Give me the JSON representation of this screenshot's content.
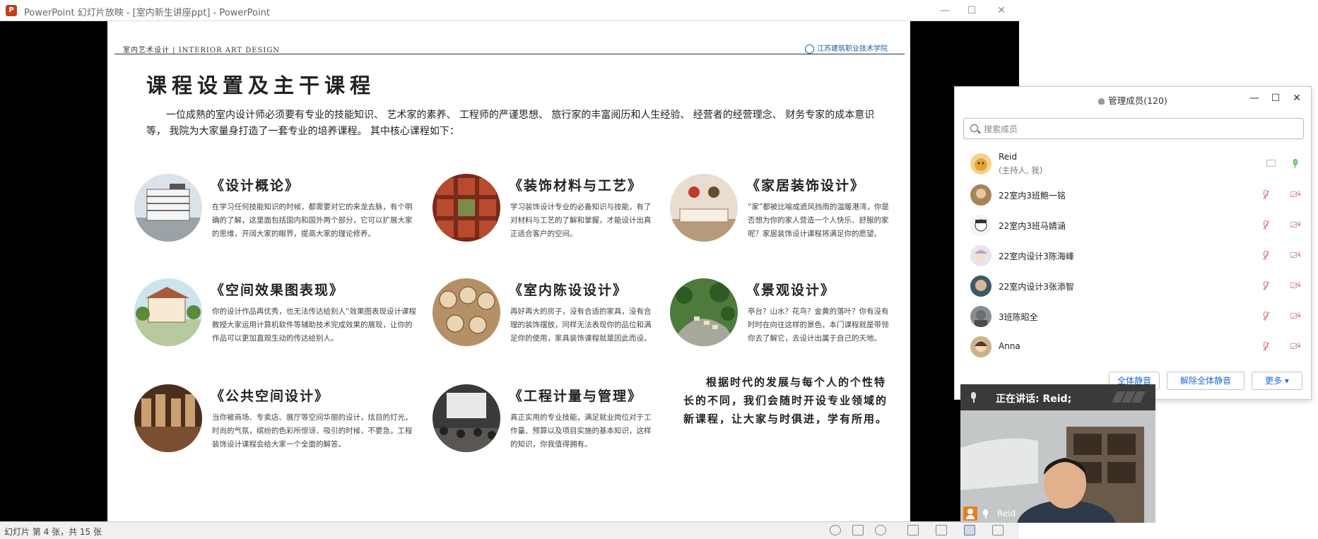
{
  "ppt": {
    "title": "PowerPoint 幻灯片放映 - [室内新生讲座ppt] - PowerPoint",
    "logo": "P",
    "status": "幻灯片 第 4 张，共 15 张"
  },
  "slide": {
    "header_left": "室内艺术设计 | INTERIOR ART DESIGN",
    "header_right": "江苏建筑职业技术学院",
    "title": "课程设置及主干课程",
    "intro": "一位成熟的室内设计师必须要有专业的技能知识、 艺术家的素养、 工程师的严谨思想、 旅行家的丰富阅历和人生经验、 经营者的经营理念、 财务专家的成本意识等， 我院为大家量身打造了一套专业的培养课程。 其中核心课程如下：",
    "courses": [
      {
        "title": "《设计概论》",
        "desc": "在学习任何技能知识的时候，都需要对它的来龙去脉，有个明确的了解，这里面包括国内和国外两个部分，它可以扩展大家的思维，开阔大家的眼界，提高大家的理论修养。"
      },
      {
        "title": "《装饰材料与工艺》",
        "desc": "学习装饰设计专业的必备知识与技能，有了对材料与工艺的了解和掌握，才能设计出真正适合客户的空间。"
      },
      {
        "title": "《家居装饰设计》",
        "desc": "“家”都被比喻成遮风挡雨的温暖港湾，你是否想为你的家人营造一个人快乐、舒服的家呢？家居装饰设计课程将满足你的愿望。"
      },
      {
        "title": "《空间效果图表现》",
        "desc": "你的设计作品再优秀，也无法传达给别人“效果图表现设计课程教授大家运用计算机软件等辅助技术完成效果的展现，让你的作品可以更加直观生动的传达给别人。"
      },
      {
        "title": "《室内陈设设计》",
        "desc": "再好再大的房子，没有合适的家具，没有合理的装饰摆放，同样无法表现你的品位和满足你的使用，家具装饰课程就是因此而设。"
      },
      {
        "title": "《景观设计》",
        "desc": "亭台？山水？花鸟？金黄的落叶？你有没有时时在向往这样的景色，本门课程就是带领你去了解它，去设计出属于自己的天地。"
      },
      {
        "title": "《公共空间设计》",
        "desc": "当你被商场、专卖店、展厅等空间华丽的设计，炫目的灯光，时尚的气氛，缤纷的色彩所惊讶、吸引的时候，不要急，工程装饰设计课程会给大家一个全面的解答。"
      },
      {
        "title": "《工程计量与管理》",
        "desc": "真正实用的专业技能，满足就业岗位对于工作量、预算以及项目实施的基本知识，这样的知识，你我值得拥有。"
      }
    ],
    "note": "根据时代的发展与每个人的个性特长的不同，我们会随时开设专业领域的新课程，让大家与时俱进，学有所用。"
  },
  "panel": {
    "title": "管理成员(120)",
    "search_placeholder": "搜索成员",
    "members": [
      {
        "name": "Reid",
        "role": "(主持人, 我)"
      },
      {
        "name": "22室内3班鲍一铭"
      },
      {
        "name": "22室内3班马婧涵"
      },
      {
        "name": "22室内设计3陈海峰"
      },
      {
        "name": "22室内设计3张添智"
      },
      {
        "name": "3班陈昭全"
      },
      {
        "name": "Anna"
      }
    ],
    "buttons": {
      "mute_all": "全体静音",
      "unmute_all": "解除全体静音",
      "more": "更多 ▾"
    }
  },
  "video": {
    "speaking": "正在讲话: Reid;",
    "name": "Reid"
  },
  "colors": {
    "accent": "#1a6ad6",
    "ppt_brand": "#c43e1c",
    "mute_red": "#d46f6f"
  }
}
